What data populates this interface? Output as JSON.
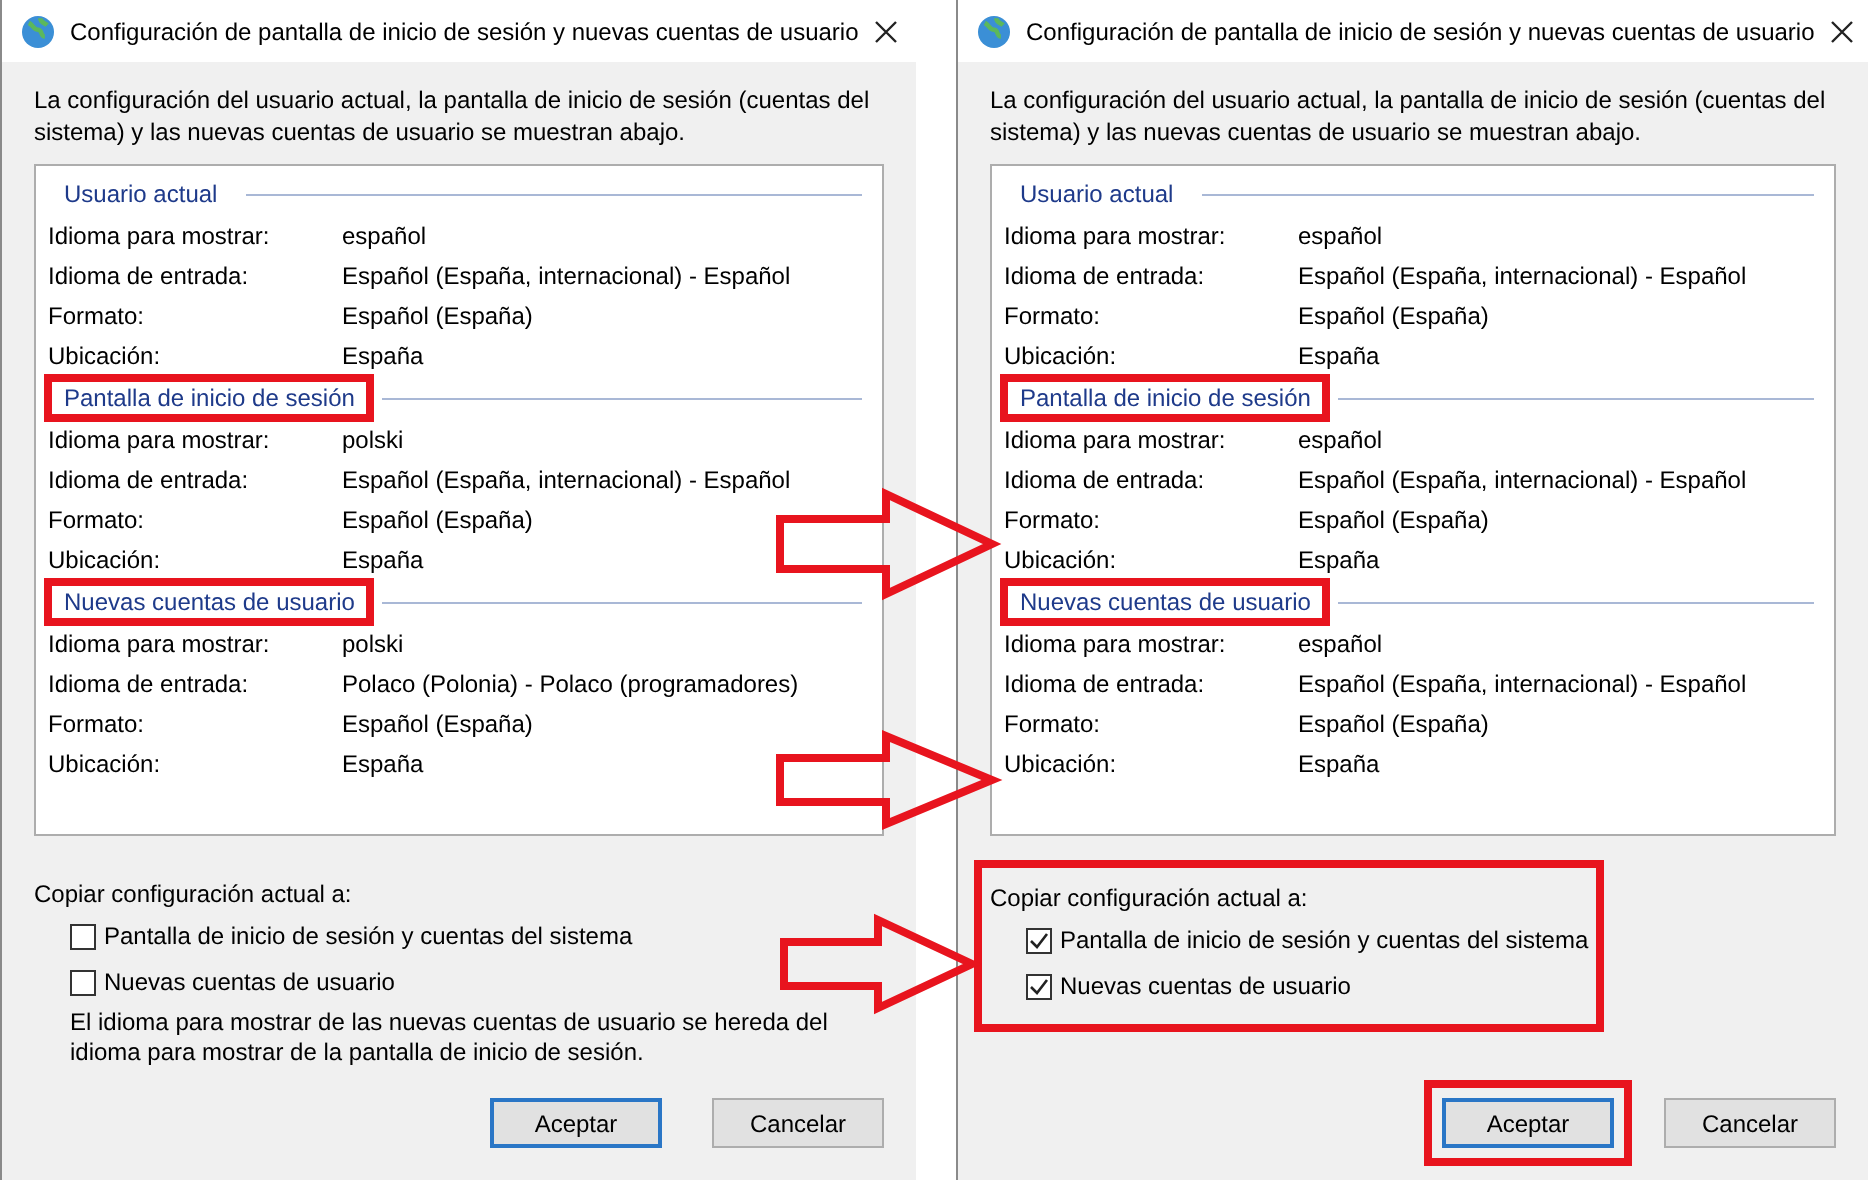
{
  "dialogs": [
    {
      "title": "Configuración de pantalla de inicio de sesión y nuevas cuentas de usuario",
      "description": "La configuración del usuario actual, la pantalla de inicio de sesión (cuentas del sistema) y las nuevas cuentas de usuario se muestran abajo.",
      "sections": [
        {
          "heading": "Usuario actual",
          "highlighted": false,
          "rows": [
            {
              "label": "Idioma para mostrar:",
              "value": "español"
            },
            {
              "label": "Idioma de entrada:",
              "value": "Español (España, internacional) - Español"
            },
            {
              "label": "Formato:",
              "value": "Español (España)"
            },
            {
              "label": "Ubicación:",
              "value": "España"
            }
          ]
        },
        {
          "heading": "Pantalla de inicio de sesión",
          "highlighted": true,
          "rows": [
            {
              "label": "Idioma para mostrar:",
              "value": "polski"
            },
            {
              "label": "Idioma de entrada:",
              "value": "Español (España, internacional) - Español"
            },
            {
              "label": "Formato:",
              "value": "Español (España)"
            },
            {
              "label": "Ubicación:",
              "value": "España"
            }
          ]
        },
        {
          "heading": "Nuevas cuentas de usuario",
          "highlighted": true,
          "rows": [
            {
              "label": "Idioma para mostrar:",
              "value": "polski"
            },
            {
              "label": "Idioma de entrada:",
              "value": "Polaco (Polonia) - Polaco (programadores)"
            },
            {
              "label": "Formato:",
              "value": "Español (España)"
            },
            {
              "label": "Ubicación:",
              "value": "España"
            }
          ]
        }
      ],
      "copy": {
        "label": "Copiar configuración actual a:",
        "highlighted": false,
        "options": [
          {
            "label": "Pantalla de inicio de sesión y cuentas del sistema",
            "checked": false
          },
          {
            "label": "Nuevas cuentas de usuario",
            "checked": false
          }
        ],
        "note": "El idioma para mostrar de las nuevas cuentas de usuario se hereda del idioma para mostrar de la pantalla de inicio de sesión."
      },
      "buttons": [
        {
          "label": "Aceptar",
          "default": true,
          "highlighted": false
        },
        {
          "label": "Cancelar",
          "default": false,
          "highlighted": false
        }
      ]
    },
    {
      "title": "Configuración de pantalla de inicio de sesión y nuevas cuentas de usuario",
      "description": "La configuración del usuario actual, la pantalla de inicio de sesión (cuentas del sistema) y las nuevas cuentas de usuario se muestran abajo.",
      "sections": [
        {
          "heading": "Usuario actual",
          "highlighted": false,
          "rows": [
            {
              "label": "Idioma para mostrar:",
              "value": "español"
            },
            {
              "label": "Idioma de entrada:",
              "value": "Español (España, internacional) - Español"
            },
            {
              "label": "Formato:",
              "value": "Español (España)"
            },
            {
              "label": "Ubicación:",
              "value": "España"
            }
          ]
        },
        {
          "heading": "Pantalla de inicio de sesión",
          "highlighted": true,
          "rows": [
            {
              "label": "Idioma para mostrar:",
              "value": "español"
            },
            {
              "label": "Idioma de entrada:",
              "value": "Español (España, internacional) - Español"
            },
            {
              "label": "Formato:",
              "value": "Español (España)"
            },
            {
              "label": "Ubicación:",
              "value": "España"
            }
          ]
        },
        {
          "heading": "Nuevas cuentas de usuario",
          "highlighted": true,
          "rows": [
            {
              "label": "Idioma para mostrar:",
              "value": "español"
            },
            {
              "label": "Idioma de entrada:",
              "value": "Español (España, internacional) - Español"
            },
            {
              "label": "Formato:",
              "value": "Español (España)"
            },
            {
              "label": "Ubicación:",
              "value": "España"
            }
          ]
        }
      ],
      "copy": {
        "label": "Copiar configuración actual a:",
        "highlighted": true,
        "options": [
          {
            "label": "Pantalla de inicio de sesión y cuentas del sistema",
            "checked": true
          },
          {
            "label": "Nuevas cuentas de usuario",
            "checked": true
          }
        ]
      },
      "buttons": [
        {
          "label": "Aceptar",
          "default": true,
          "highlighted": true
        },
        {
          "label": "Cancelar",
          "default": false,
          "highlighted": false
        }
      ]
    }
  ]
}
